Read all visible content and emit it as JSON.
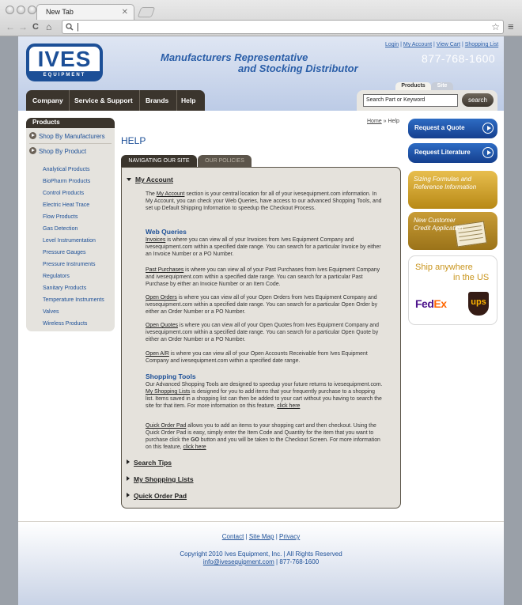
{
  "browser": {
    "tab_title": "New Tab",
    "tab_close": "✕",
    "address_value": "|",
    "back": "←",
    "forward": "→",
    "reload": "C",
    "home": "⌂",
    "star": "☆",
    "menu": "≡"
  },
  "header": {
    "logo_word": "IVES",
    "logo_sub": "EQUIPMENT",
    "tagline_line1": "Manufacturers Representative",
    "tagline_line2": "and Stocking Distributor",
    "top_links": [
      "Login",
      "My Account",
      "View Cart",
      "Shopping List"
    ],
    "top_link_sep": "|",
    "phone": "877-768-1600",
    "nav": [
      "Company",
      "Service & Support",
      "Brands",
      "Help"
    ],
    "search_tabs": [
      "Products",
      "Site"
    ],
    "search_placeholder": "Search Part or Keyword",
    "search_button": "search"
  },
  "sidebar": {
    "title": "Products",
    "shop_by_manufacturers": "Shop By Manufacturers",
    "shop_by_product": "Shop By Product",
    "items": [
      "Analytical Products",
      "BioPharm Products",
      "Control Products",
      "Electric Heat Trace",
      "Flow Products",
      "Gas Detection",
      "Level Instrumentation",
      "Pressure Gauges",
      "Pressure Instruments",
      "Regulators",
      "Sanitary Products",
      "Temperature Instruments",
      "Valves",
      "Wireless Products"
    ]
  },
  "breadcrumb": {
    "home": "Home",
    "sep": "»",
    "current": "Help"
  },
  "content": {
    "title": "HELP",
    "tabs": [
      "NAVIGATING OUR SITE",
      "OUR POLICIES"
    ],
    "my_account": {
      "heading": "My Account",
      "p1_a": "The ",
      "p1_link": "My Account",
      "p1_b": " section is your central location for all of your ivesequipment.com information. In My Account, you can check your Web Queries, have access to our advanced Shopping Tools, and set up Default Shipping Information to speedup the Checkout Process."
    },
    "web_queries": {
      "heading": "Web Queries",
      "items": [
        {
          "link": "Invoices",
          "text": " is where you can view all of your Invoices from Ives Equipment Company and ivesequipment.com within a specified date range. You can search for a particular Invoice by either an Invoice Number or a PO Number."
        },
        {
          "link": "Past Purchases",
          "text": " is where you can view all of your Past Purchases from Ives Equipment Company and ivesequipment.com within a specified date range. You can search for a particular Past Purchase by either an Invoice Number or an Item Code."
        },
        {
          "link": "Open Orders",
          "text": " is where you can view all of your Open Orders from Ives Equipment Company and ivesequipment.com within a specified date range. You can search for a particular Open Order by either an Order Number or a PO Number."
        },
        {
          "link": "Open Quotes",
          "text": " is where you can view all of your Open Quotes from Ives Equipment Company and ivesequipment.com within a specified date range. You can search for a particular Open Quote by either an Order Number or a PO Number."
        },
        {
          "link": "Open A/R",
          "text": " is where you can view all of your Open Accounts Receivable from Ives Equipment Company and ivesequipment.com within a specified date range."
        }
      ]
    },
    "shopping_tools": {
      "heading": "Shopping Tools",
      "p1_a": "Our Advanced Shopping Tools are designed to speedup your future returns to ivesequipment.com. ",
      "p1_link": "My Shopping Lists",
      "p1_b": " is designed for you to add items that your frequently purchase to a shopping list. Items saved in a shopping list can then be added to your cart without you having to search the site for that item. For more information on this feature, ",
      "p1_link2": "click here",
      "p2_link": "Quick Order Pad",
      "p2_a": " allows you to add an items to your shopping cart and then checkout. Using the Quick Order Pad is easy, simply enter the Item Code and Quantity for the item that you want to purchase click the ",
      "p2_bold": "GO",
      "p2_b": " button and you will be taken to the Checkout Screen. For more information on this feature, ",
      "p2_link2": "click here"
    },
    "collapsed": [
      "Search Tips",
      "My Shopping Lists",
      "Quick Order Pad"
    ]
  },
  "right": {
    "request_quote": "Request a Quote",
    "request_literature": "Request Literature",
    "sizing_line1": "Sizing Formulas and",
    "sizing_line2": "Reference Information",
    "credit_line1": "New Customer",
    "credit_line2": "Credit Application",
    "ship_line1": "Ship anywhere",
    "ship_line2": "in the US",
    "fedex_a": "Fed",
    "fedex_b": "Ex",
    "ups": "ups"
  },
  "footer": {
    "links": [
      "Contact",
      "Site Map",
      "Privacy"
    ],
    "sep": "|",
    "copyright": "Copyright 2010 Ives Equipment, Inc. | All Rights Reserved",
    "email": "info@ivesequipment.com",
    "phone_sep": "|",
    "phone": "877-768-1600"
  }
}
